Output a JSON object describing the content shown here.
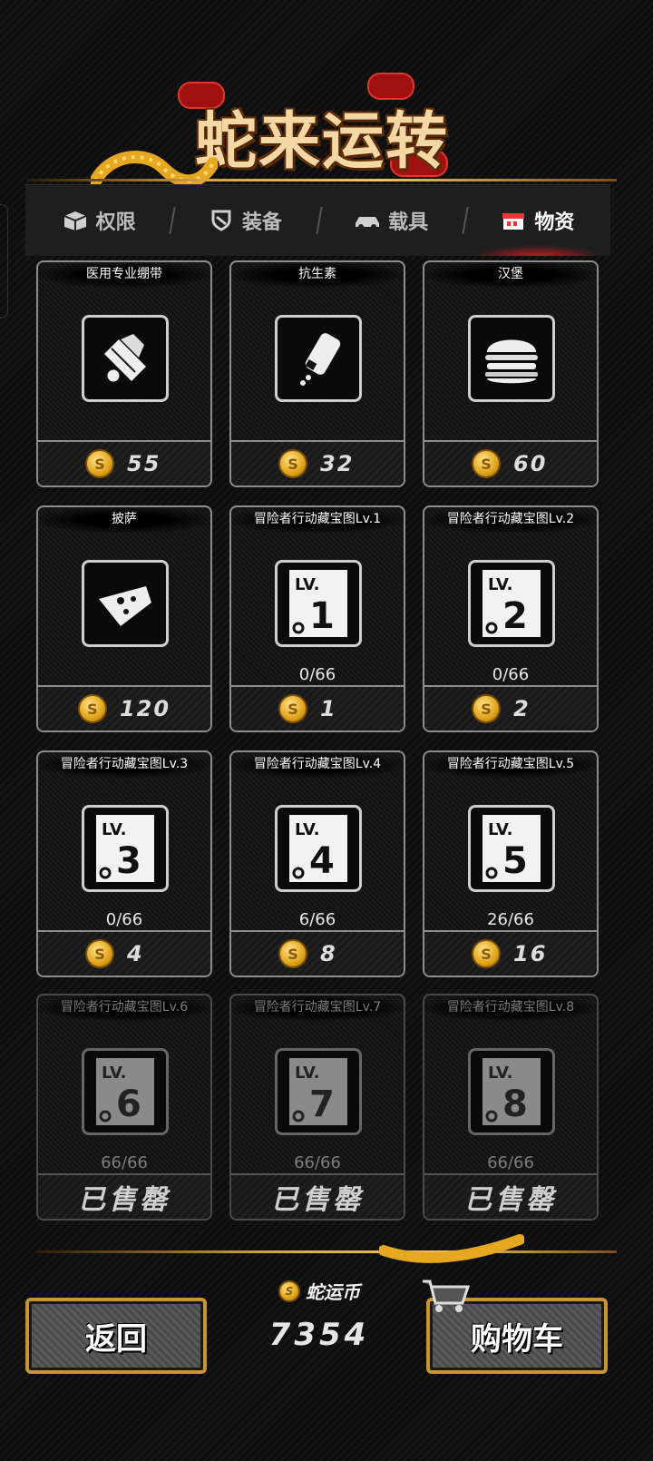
{
  "header": {
    "title": "蛇来运转"
  },
  "tabs": [
    {
      "label": "权限",
      "icon": "box-icon",
      "active": false
    },
    {
      "label": "装备",
      "icon": "shield-icon",
      "active": false
    },
    {
      "label": "载具",
      "icon": "car-icon",
      "active": false
    },
    {
      "label": "物资",
      "icon": "store-icon",
      "active": true
    }
  ],
  "items": [
    {
      "name": "医用专业绷带",
      "icon": "bandage-icon",
      "progress": "",
      "price": "55",
      "sold_out": false
    },
    {
      "name": "抗生素",
      "icon": "medicine-bottle-icon",
      "progress": "",
      "price": "32",
      "sold_out": false
    },
    {
      "name": "汉堡",
      "icon": "burger-icon",
      "progress": "",
      "price": "60",
      "sold_out": false
    },
    {
      "name": "披萨",
      "icon": "pizza-icon",
      "progress": "",
      "price": "120",
      "sold_out": false
    },
    {
      "name": "冒险者行动藏宝图Lv.1",
      "icon": "treasure-map-icon",
      "level": "1",
      "progress": "0/66",
      "price": "1",
      "sold_out": false
    },
    {
      "name": "冒险者行动藏宝图Lv.2",
      "icon": "treasure-map-icon",
      "level": "2",
      "progress": "0/66",
      "price": "2",
      "sold_out": false
    },
    {
      "name": "冒险者行动藏宝图Lv.3",
      "icon": "treasure-map-icon",
      "level": "3",
      "progress": "0/66",
      "price": "4",
      "sold_out": false
    },
    {
      "name": "冒险者行动藏宝图Lv.4",
      "icon": "treasure-map-icon",
      "level": "4",
      "progress": "6/66",
      "price": "8",
      "sold_out": false
    },
    {
      "name": "冒险者行动藏宝图Lv.5",
      "icon": "treasure-map-icon",
      "level": "5",
      "progress": "26/66",
      "price": "16",
      "sold_out": false
    },
    {
      "name": "冒险者行动藏宝图Lv.6",
      "icon": "treasure-map-icon",
      "level": "6",
      "progress": "66/66",
      "price": "",
      "sold_out": true
    },
    {
      "name": "冒险者行动藏宝图Lv.7",
      "icon": "treasure-map-icon",
      "level": "7",
      "progress": "66/66",
      "price": "",
      "sold_out": true
    },
    {
      "name": "冒险者行动藏宝图Lv.8",
      "icon": "treasure-map-icon",
      "level": "8",
      "progress": "66/66",
      "price": "",
      "sold_out": true
    }
  ],
  "sold_out_label": "已售罄",
  "map_level_prefix": "LV.",
  "footer": {
    "back_label": "返回",
    "currency_label": "蛇运币",
    "currency_amount": "7354",
    "cart_label": "购物车"
  },
  "colors": {
    "gold": "#d8a24a",
    "accent_red": "#dc1e1e",
    "card_border": "#8d8d8d"
  }
}
